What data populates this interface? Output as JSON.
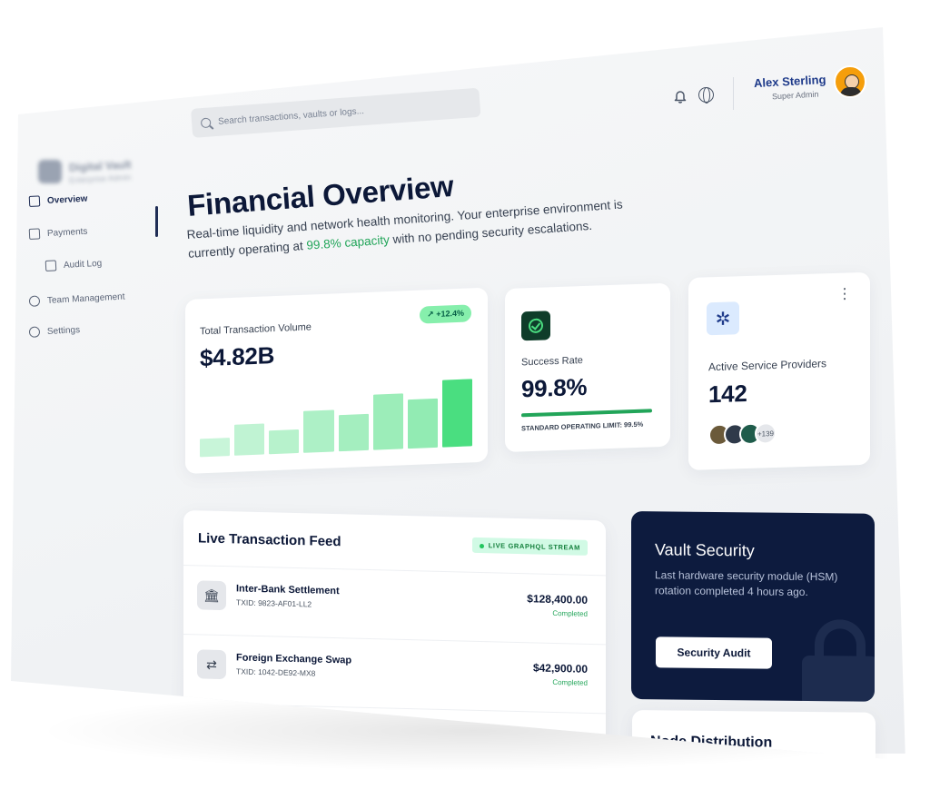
{
  "sidebar": {
    "brand_name": "Digital Vault",
    "brand_sub": "Enterprise Admin",
    "items": [
      {
        "label": "Overview",
        "active": true
      },
      {
        "label": "Payments",
        "active": false
      },
      {
        "label": "Audit Log",
        "active": false
      },
      {
        "label": "Team Management",
        "active": false
      },
      {
        "label": "Settings",
        "active": false
      }
    ]
  },
  "header": {
    "search_placeholder": "Search transactions, vaults or logs...",
    "user_name": "Alex Sterling",
    "user_role": "Super Admin"
  },
  "overview": {
    "title": "Financial Overview",
    "desc_before": "Real-time liquidity and network health monitoring. Your enterprise environment is currently operating at ",
    "desc_highlight": "99.8% capacity",
    "desc_after": " with no pending security escalations."
  },
  "volume_card": {
    "label": "Total Transaction Volume",
    "value": "$4.82B",
    "trend": "↗ +12.4%",
    "bar_levels": [
      0.25,
      0.42,
      0.33,
      0.58,
      0.5,
      0.76,
      0.68,
      0.92
    ]
  },
  "success_card": {
    "label": "Success Rate",
    "value": "99.8%",
    "progress": 0.998,
    "limit_text": "STANDARD OPERATING LIMIT: 99.5%"
  },
  "providers_card": {
    "label": "Active Service Providers",
    "value": "142",
    "extra_count": "+139"
  },
  "feed": {
    "title": "Live Transaction Feed",
    "badge": "LIVE GRAPHQL STREAM",
    "rows": [
      {
        "icon": "bank-icon",
        "name": "Inter-Bank Settlement",
        "txid": "TXID: 9823-AF01-LL2",
        "amount": "$128,400.00",
        "status": "Completed"
      },
      {
        "icon": "exchange-icon",
        "name": "Foreign Exchange Swap",
        "txid": "TXID: 1042-DE92-MX8",
        "amount": "$42,900.00",
        "status": "Completed"
      }
    ]
  },
  "vault": {
    "title": "Vault Security",
    "desc": "Last hardware security module (HSM) rotation completed 4 hours ago.",
    "button": "Security Audit"
  },
  "node": {
    "title": "Node Distribution"
  },
  "colors": {
    "accent_green": "#22a559",
    "navy": "#0d1b3e",
    "bar_green": "#4ade80"
  }
}
